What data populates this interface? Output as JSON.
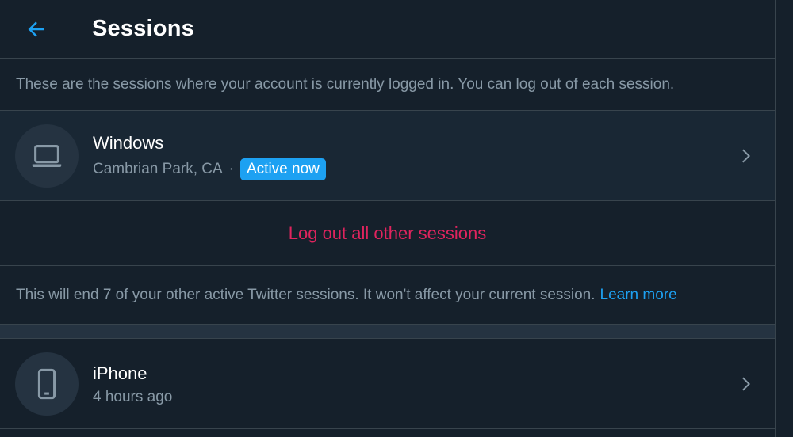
{
  "header": {
    "title": "Sessions",
    "back_icon": "arrow-left-icon",
    "accent_color": "#1da1f2"
  },
  "description": "These are the sessions where your account is currently logged in. You can log out of each session.",
  "current_session": {
    "device_icon": "laptop-icon",
    "device": "Windows",
    "location": "Cambrian Park, CA",
    "separator": "·",
    "badge": "Active now"
  },
  "logout_all": {
    "label": "Log out all other sessions",
    "color": "#e0245e"
  },
  "note": {
    "text": "This will end 7 of your other active Twitter sessions. It won't affect your current session.",
    "link": "Learn more"
  },
  "other_sessions": [
    {
      "device_icon": "phone-icon",
      "device": "iPhone",
      "time": "4 hours ago"
    }
  ]
}
